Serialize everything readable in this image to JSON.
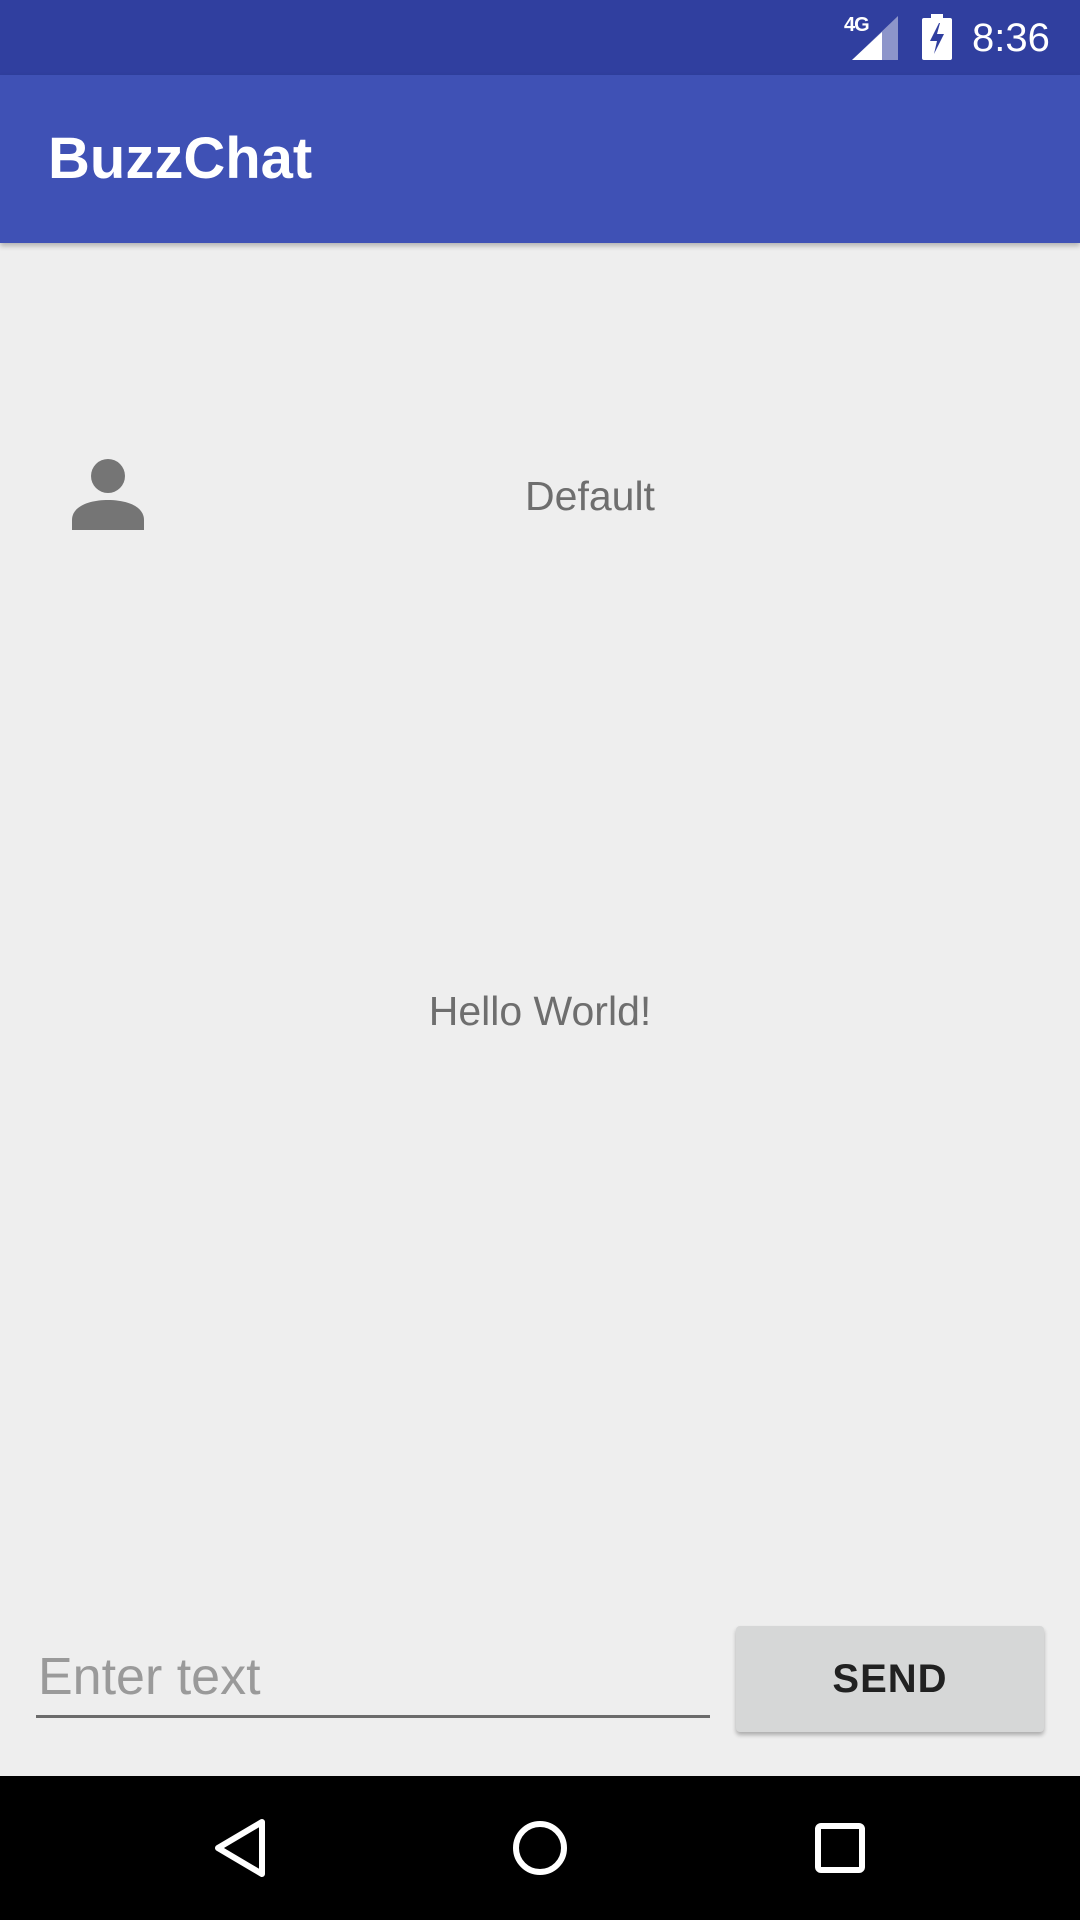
{
  "status_bar": {
    "network": "4G",
    "time": "8:36",
    "signal_icon": "signal-icon",
    "battery_icon": "battery-charging-icon"
  },
  "app_bar": {
    "title": "BuzzChat",
    "color": "#3f51b5"
  },
  "content": {
    "user_label": "Default",
    "avatar_icon": "person-icon",
    "message": "Hello World!"
  },
  "compose": {
    "placeholder": "Enter text",
    "value": "",
    "send_label": "SEND"
  },
  "nav_bar": {
    "back_icon": "back-icon",
    "home_icon": "home-icon",
    "recent_icon": "recent-apps-icon"
  },
  "colors": {
    "status_bar": "#303f9f",
    "app_bar": "#3f51b5",
    "background": "#eeeeee",
    "button": "#d6d7d7"
  }
}
